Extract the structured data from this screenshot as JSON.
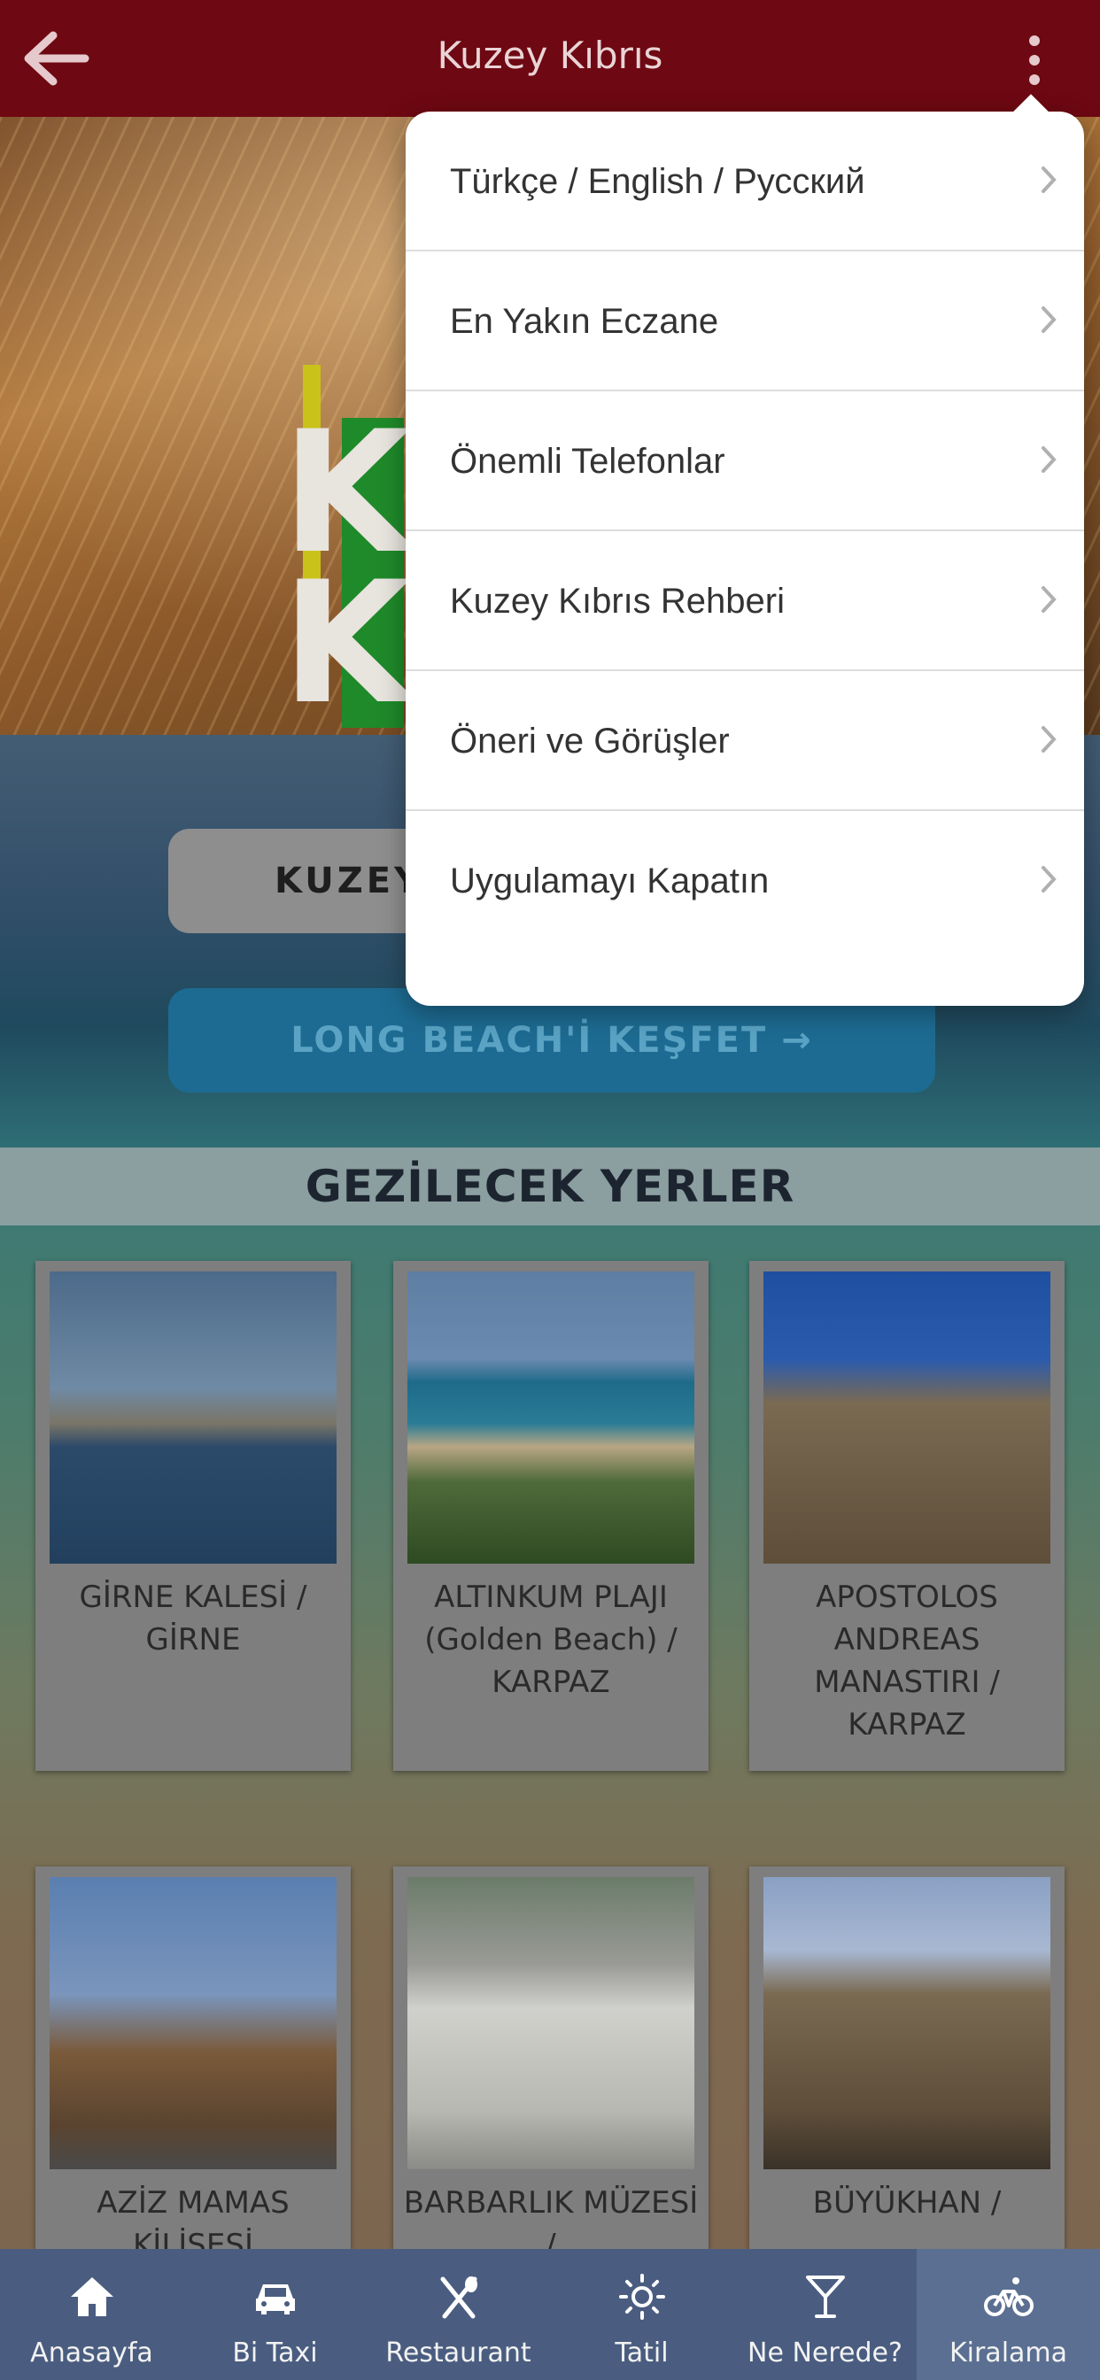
{
  "header": {
    "title": "Kuzey Kıbrıs"
  },
  "hero": {
    "logo_text": "KU\nK"
  },
  "buttons": {
    "primary": "KUZEY",
    "secondary": "LONG BEACH'İ KEŞFET →"
  },
  "section": {
    "title": "GEZİLECEK YERLER"
  },
  "places": [
    {
      "name": "GİRNE KALESİ / GİRNE"
    },
    {
      "name": "ALTINKUM PLAJI (Golden Beach) / KARPAZ"
    },
    {
      "name": "APOSTOLOS ANDREAS MANASTIRI / KARPAZ"
    },
    {
      "name": "AZİZ MAMAS KİLİSESİ"
    },
    {
      "name": "BARBARLIK MÜZESİ /"
    },
    {
      "name": "BÜYÜKHAN /"
    }
  ],
  "menu": {
    "items": [
      "Türkçe / English / Русский",
      "En Yakın Eczane",
      "Önemli Telefonlar",
      "Kuzey Kıbrıs Rehberi",
      "Öneri ve Görüşler",
      "Uygulamayı Kapatın"
    ]
  },
  "bottom_nav": [
    {
      "label": "Anasayfa",
      "icon": "home-icon"
    },
    {
      "label": "Bi Taxi",
      "icon": "car-icon"
    },
    {
      "label": "Restaurant",
      "icon": "fork-knife-icon"
    },
    {
      "label": "Tatil",
      "icon": "sun-icon"
    },
    {
      "label": "Ne Nerede?",
      "icon": "cocktail-icon"
    },
    {
      "label": "Kiralama",
      "icon": "bicycle-icon"
    }
  ]
}
